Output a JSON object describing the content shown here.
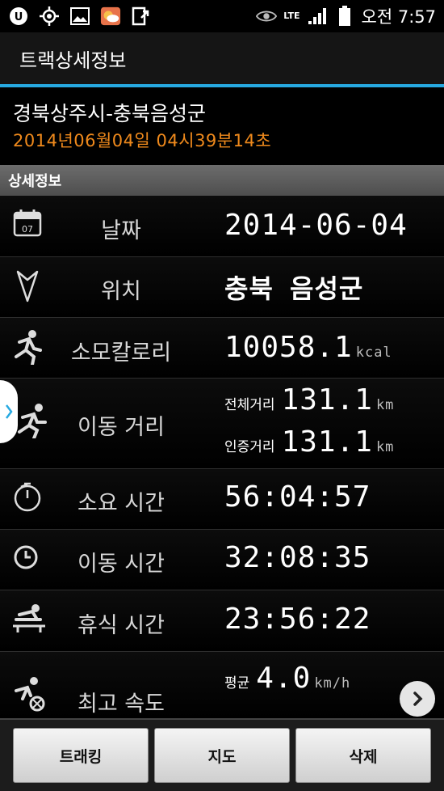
{
  "status_bar": {
    "network": "LTE",
    "time": "오전 7:57"
  },
  "app_bar": {
    "title": "트랙상세정보"
  },
  "header": {
    "title": "경북상주시-충북음성군",
    "datetime": "2014년06월04일  04시39분14초"
  },
  "section": {
    "title": "상세정보"
  },
  "rows": {
    "date": {
      "label": "날짜",
      "value": "2014-06-04"
    },
    "location": {
      "label": "위치",
      "value": "충북 음성군"
    },
    "calories": {
      "label": "소모칼로리",
      "value": "10058.1",
      "unit": "kcal"
    },
    "distance": {
      "label": "이동 거리",
      "total_prefix": "전체거리",
      "total_value": "131.1",
      "total_unit": "km",
      "cert_prefix": "인증거리",
      "cert_value": "131.1",
      "cert_unit": "km"
    },
    "elapsed": {
      "label": "소요 시간",
      "value": "56:04:57"
    },
    "moving": {
      "label": "이동 시간",
      "value": "32:08:35"
    },
    "rest": {
      "label": "휴식 시간",
      "value": "23:56:22"
    },
    "speed": {
      "label": "최고 속도",
      "avg_prefix": "평균",
      "avg_value": "4.0",
      "avg_unit": "km/h"
    }
  },
  "buttons": {
    "tracking": "트래킹",
    "map": "지도",
    "delete": "삭제"
  },
  "colors": {
    "accent_blue": "#27a9e1",
    "date_orange": "#f08a1c"
  }
}
